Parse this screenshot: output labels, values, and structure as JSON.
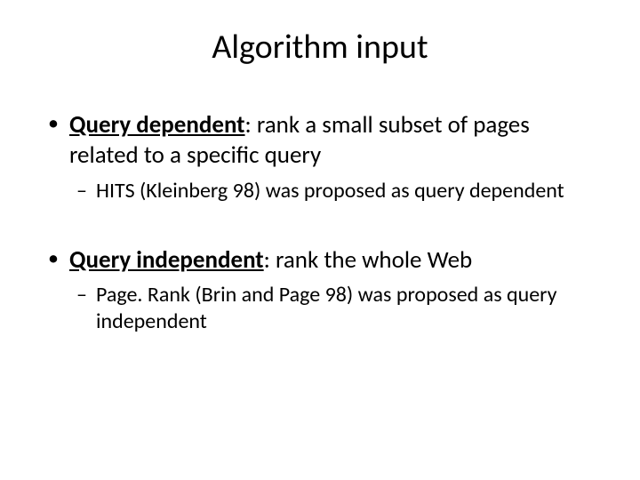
{
  "title": "Algorithm input",
  "bullets": [
    {
      "bold": "Query dependent",
      "rest": ": rank a small subset of pages related to a specific query",
      "sub": "HITS (Kleinberg 98) was proposed as query dependent"
    },
    {
      "bold": "Query independent",
      "rest": ": rank the whole Web",
      "sub": "Page. Rank (Brin and Page 98) was proposed as query independent"
    }
  ]
}
